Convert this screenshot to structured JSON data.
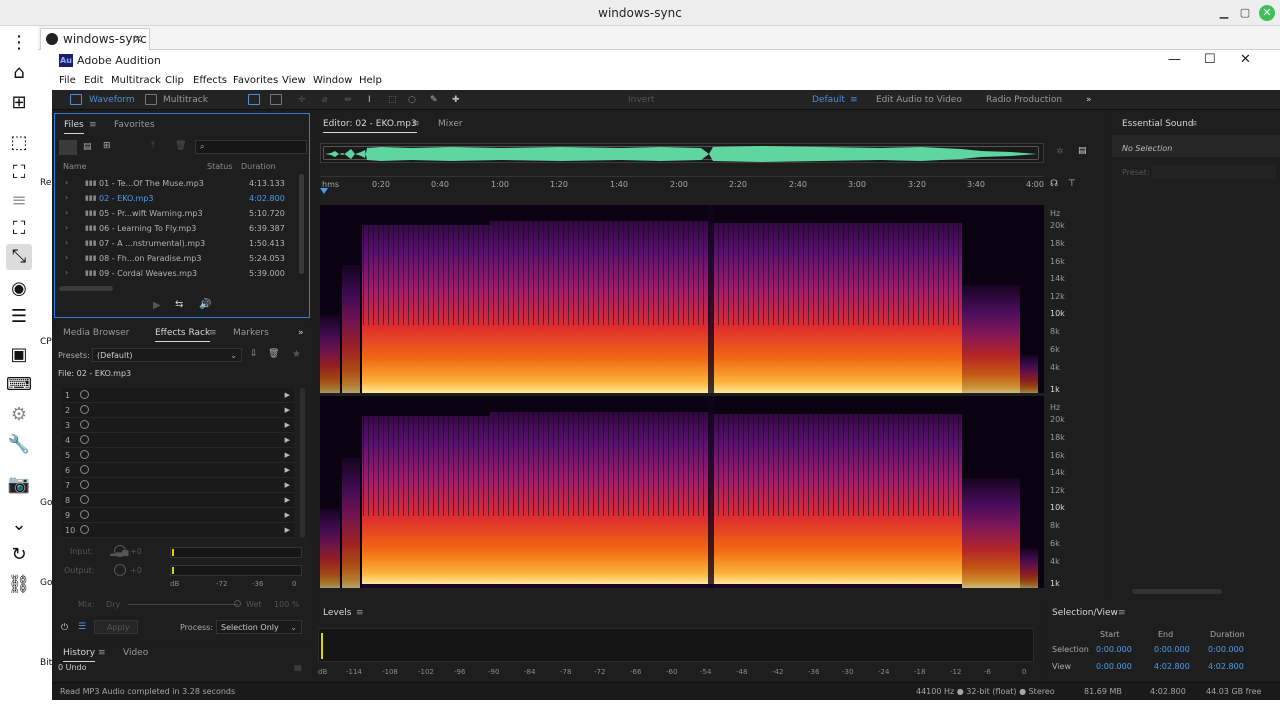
{
  "outer": {
    "title": "windows-sync",
    "tab_label": "windows-sync",
    "cut_labels": [
      "Re",
      "CP",
      "Go",
      "Go",
      "Bit"
    ]
  },
  "app": {
    "title": "Adobe Audition",
    "logo_text": "Au",
    "menu": [
      "File",
      "Edit",
      "Multitrack",
      "Clip",
      "Effects",
      "Favorites",
      "View",
      "Window",
      "Help"
    ],
    "toolbar": {
      "waveform": "Waveform",
      "multitrack": "Multitrack",
      "invert": "Invert",
      "workspaces": [
        "Default",
        "Edit Audio to Video",
        "Radio Production"
      ]
    }
  },
  "files_panel": {
    "tabs": [
      "Files",
      "Favorites"
    ],
    "col_name": "Name",
    "col_status": "Status",
    "col_duration": "Duration",
    "rows": [
      {
        "name": "01 - Te...Of The Muse.mp3",
        "duration": "4:13.133"
      },
      {
        "name": "02 - EKO.mp3",
        "duration": "4:02.800"
      },
      {
        "name": "05 - Pr...wift Warning.mp3",
        "duration": "5:10.720"
      },
      {
        "name": "06 - Learning To Fly.mp3",
        "duration": "6:39.387"
      },
      {
        "name": "07 - A ...nstrumental).mp3",
        "duration": "1:50.413"
      },
      {
        "name": "08 - Fh...on Paradise.mp3",
        "duration": "5:24.053"
      },
      {
        "name": "09 - Cordal Weaves.mp3",
        "duration": "5:39.000"
      }
    ]
  },
  "effects_panel": {
    "tabs": [
      "Media Browser",
      "Effects Rack",
      "Markers"
    ],
    "presets_label": "Presets:",
    "presets_value": "(Default)",
    "file_label": "File: 02 - EKO.mp3",
    "slots": [
      "1",
      "2",
      "3",
      "4",
      "5",
      "6",
      "7",
      "8",
      "9",
      "10"
    ],
    "input_label": "Input:",
    "output_label": "Output:",
    "input_val": "+0",
    "output_val": "+0",
    "meter_ticks": [
      "dB",
      "-72",
      "-36",
      "0"
    ],
    "mix_label": "Mix:",
    "dry_label": "Dry",
    "wet_label": "Wet",
    "wet_val": "100 %",
    "apply_label": "Apply",
    "process_label": "Process:",
    "process_value": "Selection Only"
  },
  "history_panel": {
    "tabs": [
      "History",
      "Video"
    ],
    "item": "0 Undo"
  },
  "editor": {
    "tab_label": "Editor: 02 - EKO.mp3",
    "mixer_label": "Mixer",
    "ruler": [
      "hms",
      "0:20",
      "0:40",
      "1:00",
      "1:20",
      "1:40",
      "2:00",
      "2:20",
      "2:40",
      "3:00",
      "3:20",
      "3:40",
      "4:00"
    ],
    "freq_labels": [
      "Hz",
      "20k",
      "18k",
      "16k",
      "14k",
      "12k",
      "10k",
      "8k",
      "6k",
      "4k",
      "1k"
    ]
  },
  "essential": {
    "title": "Essential Sound",
    "no_selection": "No Selection",
    "preset_label": "Preset:"
  },
  "levels": {
    "title": "Levels",
    "ticks": [
      "dB",
      "-114",
      "-108",
      "-102",
      "-96",
      "-90",
      "-84",
      "-78",
      "-72",
      "-66",
      "-60",
      "-54",
      "-48",
      "-42",
      "-36",
      "-30",
      "-24",
      "-18",
      "-12",
      "-6",
      "0"
    ]
  },
  "selview": {
    "title": "Selection/View",
    "start": "Start",
    "end": "End",
    "duration": "Duration",
    "selection_label": "Selection",
    "view_label": "View",
    "sel_start": "0:00.000",
    "sel_end": "0:00.000",
    "sel_dur": "0:00.000",
    "view_start": "0:00.000",
    "view_end": "4:02.800",
    "view_dur": "4:02.800"
  },
  "status": {
    "message": "Read MP3 Audio completed in 3.28 seconds",
    "format": "44100 Hz ● 32-bit (float) ● Stereo",
    "size": "81.69 MB",
    "length": "4:02.800",
    "free": "44.03 GB free"
  },
  "colors": {
    "accent": "#2f7bd8",
    "waveform": "#5fd6a0",
    "selected_text": "#4a9cf0"
  }
}
